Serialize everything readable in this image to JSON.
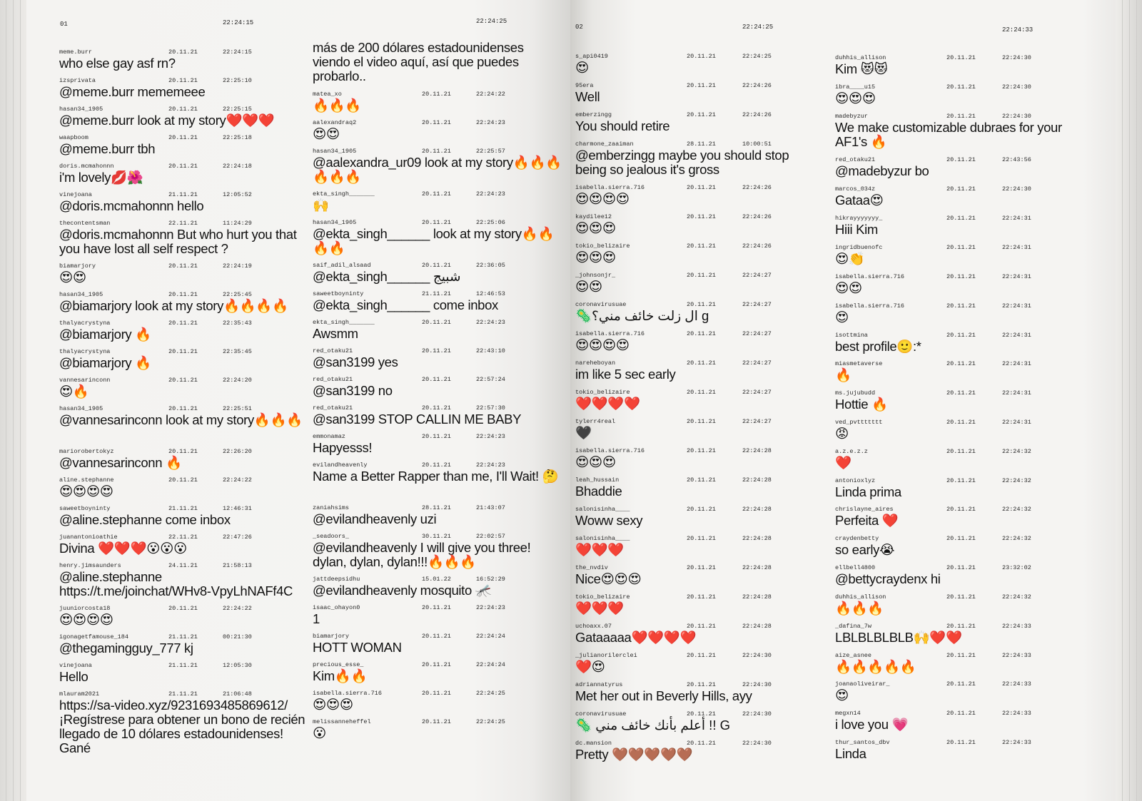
{
  "pages": [
    {
      "number": "01",
      "columns": [
        {
          "header_time": "22:24:15",
          "entries": [
            {
              "user": "meme.burr",
              "date": "20.11.21",
              "time": "22:24:15",
              "text": "who else gay asf rn?"
            },
            {
              "user": "izsprivata",
              "date": "20.11.21",
              "time": "22:25:10",
              "text": "@meme.burr mememeee"
            },
            {
              "user": "hasan34_1905",
              "date": "20.11.21",
              "time": "22:25:15",
              "text": "@meme.burr look at my story❤️❤️❤️"
            },
            {
              "user": "waapboom",
              "date": "20.11.21",
              "time": "22:25:18",
              "text": "@meme.burr tbh"
            },
            {
              "user": "doris.mcmahonnn",
              "date": "20.11.21",
              "time": "22:24:18",
              "text": "i'm lovely💋🌺"
            },
            {
              "user": "vinejoana",
              "date": "21.11.21",
              "time": "12:05:52",
              "text": "@doris.mcmahonnn hello"
            },
            {
              "user": "thecontentsman",
              "date": "22.11.21",
              "time": "11:24:29",
              "text": "@doris.mcmahonnn But who hurt you that you have lost all self respect ?"
            },
            {
              "user": "biamarjory",
              "date": "20.11.21",
              "time": "22:24:19",
              "text": "😍😍"
            },
            {
              "user": "hasan34_1905",
              "date": "20.11.21",
              "time": "22:25:45",
              "text": "@biamarjory look at my story🔥🔥🔥🔥"
            },
            {
              "user": "thalyacrystyna",
              "date": "20.11.21",
              "time": "22:35:43",
              "text": "@biamarjory 🔥"
            },
            {
              "user": "thalyacrystyna",
              "date": "20.11.21",
              "time": "22:35:45",
              "text": "@biamarjory 🔥"
            },
            {
              "user": "vannesarinconn",
              "date": "20.11.21",
              "time": "22:24:20",
              "text": "😍🔥"
            },
            {
              "user": "hasan34_1905",
              "date": "20.11.21",
              "time": "22:25:51",
              "text": "@vannesarinconn look at my story🔥🔥🔥"
            },
            {
              "user": "mariorobertokyz",
              "date": "20.11.21",
              "time": "22:26:20",
              "text": "@vannesarinconn 🔥"
            },
            {
              "user": "aline.stephanne",
              "date": "20.11.21",
              "time": "22:24:22",
              "text": "😍😍😍😍"
            },
            {
              "user": "saweetboyninty",
              "date": "21.11.21",
              "time": "12:46:31",
              "text": "@aline.stephanne come inbox"
            },
            {
              "user": "juanantonioathie",
              "date": "22.11.21",
              "time": "22:47:26",
              "text": "Divina ❤️❤️❤️😮😮😮"
            },
            {
              "user": "henry.jimsaunders",
              "date": "24.11.21",
              "time": "21:58:13",
              "text": "@aline.stephanne https://t.me/joinchat/WHv8-VpyLhNAFf4C"
            },
            {
              "user": "juuniorcosta18",
              "date": "20.11.21",
              "time": "22:24:22",
              "text": "😍😍😍😍"
            },
            {
              "user": "igonagetfamouse_184",
              "date": "21.11.21",
              "time": "00:21:30",
              "text": "@thegamingguy_777 kj"
            },
            {
              "user": "vinejoana",
              "date": "21.11.21",
              "time": "12:05:30",
              "text": "Hello"
            },
            {
              "user": "mlauram2021",
              "date": "21.11.21",
              "time": "21:06:48",
              "text": "https://sa-video.xyz/9231693485869612/ ¡Regístrese para obtener un bono de recién llegado de 10 dólares estadounidenses! Gané"
            }
          ]
        },
        {
          "header_time": "22:24:25",
          "continuation": "más de 200 dólares estadounidenses viendo el video aquí, así que puedes probarlo..",
          "entries": [
            {
              "user": "matea_xo",
              "date": "20.11.21",
              "time": "22:24:22",
              "text": "🔥🔥🔥"
            },
            {
              "user": "aalexandraq2",
              "date": "20.11.21",
              "time": "22:24:23",
              "text": "😍😍"
            },
            {
              "user": "hasan34_1905",
              "date": "20.11.21",
              "time": "22:25:57",
              "text": "@aalexandra_ur09 look at my story🔥🔥🔥🔥🔥🔥"
            },
            {
              "user": "ekta_singh_______",
              "date": "20.11.21",
              "time": "22:24:23",
              "text": "🙌"
            },
            {
              "user": "hasan34_1905",
              "date": "20.11.21",
              "time": "22:25:06",
              "text": "@ekta_singh______ look at my story🔥🔥🔥🔥"
            },
            {
              "user": "saif_adil_alsaad",
              "date": "20.11.21",
              "time": "22:36:05",
              "text": "@ekta_singh______ شبيج"
            },
            {
              "user": "saweetboyninty",
              "date": "21.11.21",
              "time": "12:46:53",
              "text": "@ekta_singh______ come inbox"
            },
            {
              "user": "ekta_singh_______",
              "date": "20.11.21",
              "time": "22:24:23",
              "text": "Awsmm"
            },
            {
              "user": "red_otaku21",
              "date": "20.11.21",
              "time": "22:43:10",
              "text": "@san3199 yes"
            },
            {
              "user": "red_otaku21",
              "date": "20.11.21",
              "time": "22:57:24",
              "text": "@san3199 no"
            },
            {
              "user": "red_otaku21",
              "date": "20.11.21",
              "time": "22:57:30",
              "text": "@san3199 STOP CALLIN ME BABY"
            },
            {
              "user": "emmonamaz",
              "date": "20.11.21",
              "time": "22:24:23",
              "text": "Hapyesss!"
            },
            {
              "user": "evilandheavenly",
              "date": "20.11.21",
              "time": "22:24:23",
              "text": "Name a Better Rapper than me, I'll Wait! 🤔"
            },
            {
              "user": "zaniahsims",
              "date": "28.11.21",
              "time": "21:43:07",
              "text": "@evilandheavenly uzi"
            },
            {
              "user": "_seadoors_",
              "date": "30.11.21",
              "time": "22:02:57",
              "text": "@evilandheavenly I will give you three! dylan, dylan, dylan!!!🔥🔥🔥"
            },
            {
              "user": "jattdeepsidhu",
              "date": "15.01.22",
              "time": "16:52:29",
              "text": "@evilandheavenly mosquito 🦟"
            },
            {
              "user": "isaac_ohayon0",
              "date": "20.11.21",
              "time": "22:24:23",
              "text": "1"
            },
            {
              "user": "biamarjory",
              "date": "20.11.21",
              "time": "22:24:24",
              "text": "HOTT WOMAN"
            },
            {
              "user": "precious_esse_",
              "date": "20.11.21",
              "time": "22:24:24",
              "text": "Kim🔥🔥"
            },
            {
              "user": "isabella.sierra.716",
              "date": "20.11.21",
              "time": "22:24:25",
              "text": "😍😍😍"
            },
            {
              "user": "melissanneheffel",
              "date": "20.11.21",
              "time": "22:24:25",
              "text": "😮"
            }
          ]
        }
      ]
    },
    {
      "number": "02",
      "columns": [
        {
          "header_time": "22:24:25",
          "entries": [
            {
              "user": "s_api0419",
              "date": "20.11.21",
              "time": "22:24:25",
              "text": "😍"
            },
            {
              "user": "95era",
              "date": "20.11.21",
              "time": "22:24:26",
              "text": "Well"
            },
            {
              "user": "emberzingg",
              "date": "20.11.21",
              "time": "22:24:26",
              "text": "You should retire"
            },
            {
              "user": "charmone_zaaiman",
              "date": "28.11.21",
              "time": "10:00:51",
              "text": "@emberzingg maybe you should stop being so jealous it's gross"
            },
            {
              "user": "isabella.sierra.716",
              "date": "20.11.21",
              "time": "22:24:26",
              "text": "😍😍😍😍"
            },
            {
              "user": "kaydilee12",
              "date": "20.11.21",
              "time": "22:24:26",
              "text": "😍😍😍"
            },
            {
              "user": "tokio_belizaire",
              "date": "20.11.21",
              "time": "22:24:26",
              "text": "😍😍😍"
            },
            {
              "user": "_johnsonjr_",
              "date": "20.11.21",
              "time": "22:24:27",
              "text": "😍😍"
            },
            {
              "user": "coronavirusuae",
              "date": "20.11.21",
              "time": "22:24:27",
              "text": "🦠ال زلت خائف مني؟ g"
            },
            {
              "user": "isabella.sierra.716",
              "date": "20.11.21",
              "time": "22:24:27",
              "text": "😍😍😍😍"
            },
            {
              "user": "nareheboyan",
              "date": "20.11.21",
              "time": "22:24:27",
              "text": "im like 5 sec early"
            },
            {
              "user": "tokio_belizaire",
              "date": "20.11.21",
              "time": "22:24:27",
              "text": "❤️❤️❤️❤️"
            },
            {
              "user": "tylerr4real",
              "date": "20.11.21",
              "time": "22:24:27",
              "text": "🖤"
            },
            {
              "user": "isabella.sierra.716",
              "date": "20.11.21",
              "time": "22:24:28",
              "text": "😍😍😍"
            },
            {
              "user": "leah_hussain",
              "date": "20.11.21",
              "time": "22:24:28",
              "text": "Bhaddie"
            },
            {
              "user": "salonisinha____",
              "date": "20.11.21",
              "time": "22:24:28",
              "text": "Woww sexy"
            },
            {
              "user": "salonisinha____",
              "date": "20.11.21",
              "time": "22:24:28",
              "text": "❤️❤️❤️"
            },
            {
              "user": "the_nvdiv",
              "date": "20.11.21",
              "time": "22:24:28",
              "text": "Nice😍😍😍"
            },
            {
              "user": "tokio_belizaire",
              "date": "20.11.21",
              "time": "22:24:28",
              "text": "❤️❤️❤️"
            },
            {
              "user": "uchoaxx.07",
              "date": "20.11.21",
              "time": "22:24:28",
              "text": "Gataaaaa❤️❤️❤️❤️"
            },
            {
              "user": "_julianorilerclei",
              "date": "20.11.21",
              "time": "22:24:30",
              "text": "❤️😍"
            },
            {
              "user": "adriannatyrus",
              "date": "20.11.21",
              "time": "22:24:30",
              "text": "Met her out in Beverly Hills, ayy"
            },
            {
              "user": "coronavirusuae",
              "date": "20.11.21",
              "time": "22:24:30",
              "text": "🦠 أعلم بأنك خائف مني !! G"
            },
            {
              "user": "dc.mansion",
              "date": "20.11.21",
              "time": "22:24:30",
              "text": "Pretty 🤎🤎🤎🤎🤎"
            }
          ]
        },
        {
          "header_time": "22:24:33",
          "entries": [
            {
              "user": "duhhis_allison",
              "date": "20.11.21",
              "time": "22:24:30",
              "text": "Kim 😻😻"
            },
            {
              "user": "ibra____u15",
              "date": "20.11.21",
              "time": "22:24:30",
              "text": "😍😍😍"
            },
            {
              "user": "madebyzur",
              "date": "20.11.21",
              "time": "22:24:30",
              "text": "We make customizable dubraes for your AF1's 🔥"
            },
            {
              "user": "red_otaku21",
              "date": "20.11.21",
              "time": "22:43:56",
              "text": "@madebyzur bo"
            },
            {
              "user": "marcos_034z",
              "date": "20.11.21",
              "time": "22:24:30",
              "text": "Gataa😍"
            },
            {
              "user": "hikrayyyyyyy_",
              "date": "20.11.21",
              "time": "22:24:31",
              "text": "Hiii Kim"
            },
            {
              "user": "ingridbuenofc",
              "date": "20.11.21",
              "time": "22:24:31",
              "text": "😍👏"
            },
            {
              "user": "isabella.sierra.716",
              "date": "20.11.21",
              "time": "22:24:31",
              "text": "😍😍"
            },
            {
              "user": "isabella.sierra.716",
              "date": "20.11.21",
              "time": "22:24:31",
              "text": "😍"
            },
            {
              "user": "isottmina",
              "date": "20.11.21",
              "time": "22:24:31",
              "text": "best profile🙂:*"
            },
            {
              "user": "miasmetaverse",
              "date": "20.11.21",
              "time": "22:24:31",
              "text": "🔥"
            },
            {
              "user": "ms.jujubudd",
              "date": "20.11.21",
              "time": "22:24:31",
              "text": "Hottie 🔥"
            },
            {
              "user": "ved_pvttttttt",
              "date": "20.11.21",
              "time": "22:24:31",
              "text": "😡"
            },
            {
              "user": "a.z.e.z.z",
              "date": "20.11.21",
              "time": "22:24:32",
              "text": "❤️"
            },
            {
              "user": "antonioxlyz",
              "date": "20.11.21",
              "time": "22:24:32",
              "text": "Linda prima"
            },
            {
              "user": "chrislayne_aires",
              "date": "20.11.21",
              "time": "22:24:32",
              "text": "Perfeita ❤️"
            },
            {
              "user": "craydenbetty",
              "date": "20.11.21",
              "time": "22:24:32",
              "text": "so early😭"
            },
            {
              "user": "ellbell4800",
              "date": "20.11.21",
              "time": "23:32:02",
              "text": "@bettycraydenx hi"
            },
            {
              "user": "duhhis_allison",
              "date": "20.11.21",
              "time": "22:24:32",
              "text": "🔥🔥🔥"
            },
            {
              "user": "_dafina_7w",
              "date": "20.11.21",
              "time": "22:24:33",
              "text": "LBLBLBLBLB🙌❤️❤️"
            },
            {
              "user": "aize_asnee",
              "date": "20.11.21",
              "time": "22:24:33",
              "text": "🔥🔥🔥🔥🔥"
            },
            {
              "user": "joanaoliveirar_",
              "date": "20.11.21",
              "time": "22:24:33",
              "text": "😍"
            },
            {
              "user": "megxn14",
              "date": "20.11.21",
              "time": "22:24:33",
              "text": "i love you 💗"
            },
            {
              "user": "thur_santos_dbv",
              "date": "20.11.21",
              "time": "22:24:33",
              "text": "Linda"
            }
          ]
        }
      ]
    }
  ]
}
